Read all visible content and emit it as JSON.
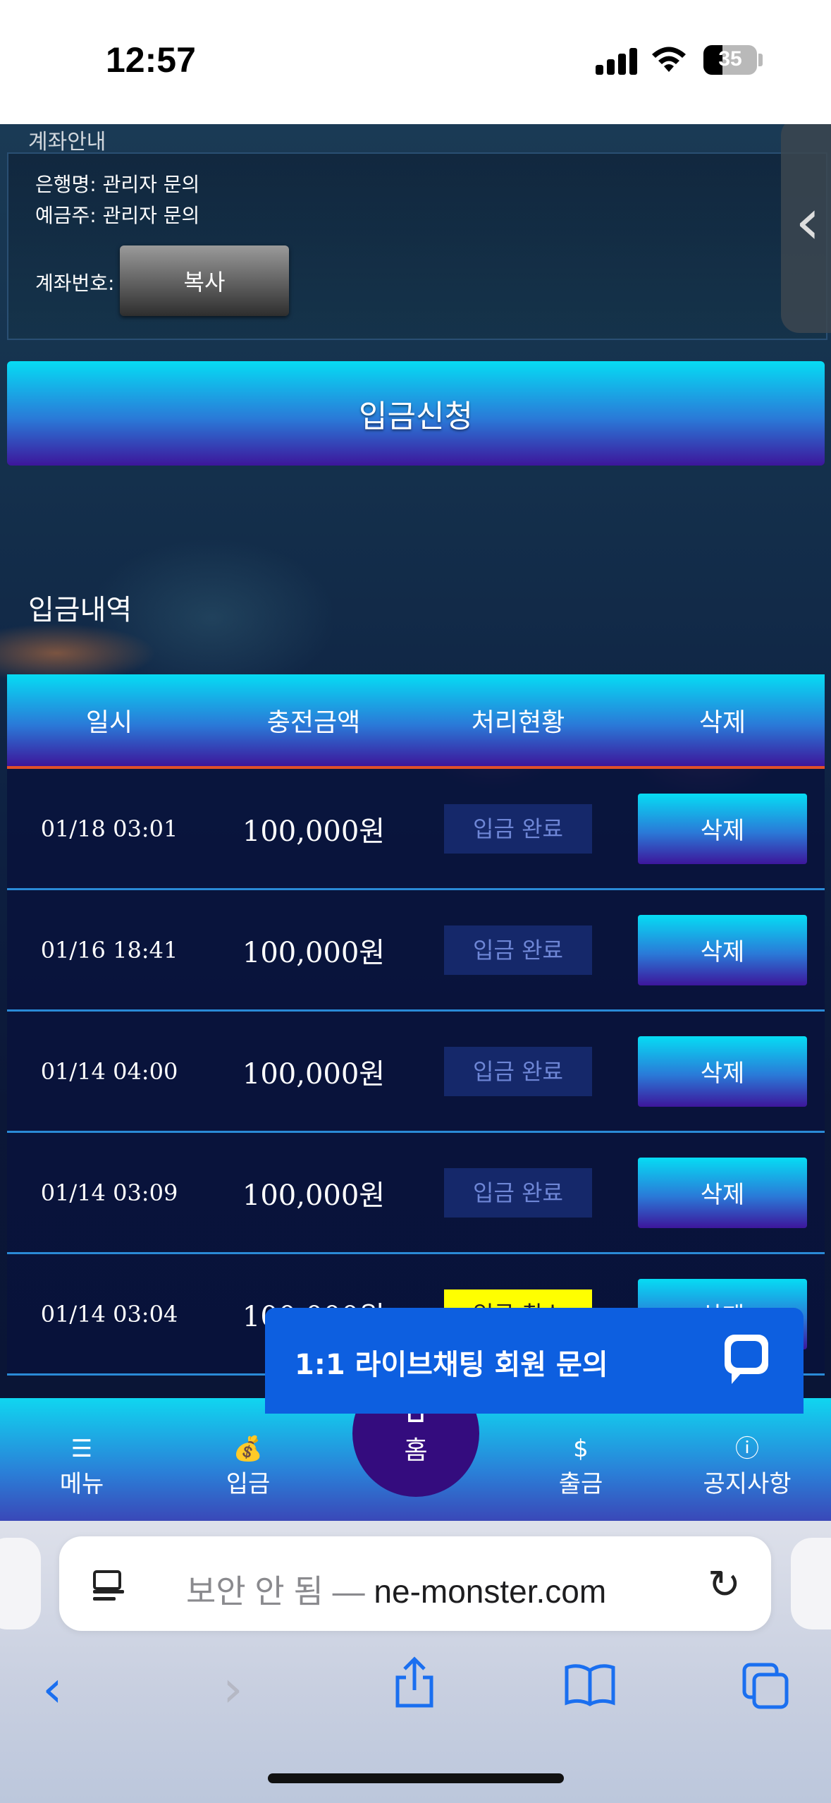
{
  "status_bar": {
    "time": "12:57",
    "battery": "35",
    "battery_level": 0.35
  },
  "account_section": {
    "cut_label": "계좌안내",
    "bank_name": "은행명: 관리자 문의",
    "holder": "예금주: 관리자 문의",
    "account_label": "계좌번호:",
    "copy_button": "복사"
  },
  "deposit_request_button": "입금신청",
  "history_title": "입금내역",
  "table": {
    "headers": [
      "일시",
      "충전금액",
      "처리현황",
      "삭제"
    ],
    "rows": [
      {
        "date": "01/18 03:01",
        "amount": "100,000원",
        "status": "입금 완료",
        "action": "삭제"
      },
      {
        "date": "01/16 18:41",
        "amount": "100,000원",
        "status": "입금 완료",
        "action": "삭제"
      },
      {
        "date": "01/14 04:00",
        "amount": "100,000원",
        "status": "입금 완료",
        "action": "삭제"
      },
      {
        "date": "01/14 03:09",
        "amount": "100,000원",
        "status": "입금 완료",
        "action": "삭제"
      },
      {
        "date": "01/14 03:04",
        "amount": "100,000원",
        "status": "입금 취소",
        "action": "삭제"
      }
    ]
  },
  "chat_banner": "1:1 라이브채팅 회원 문의",
  "bottom_nav": {
    "menu": "메뉴",
    "deposit": "입금",
    "home": "홈",
    "withdraw": "출금",
    "notice": "공지사항"
  },
  "browser": {
    "url_prefix": "보안 안 됨 — ",
    "url_domain": "ne-monster.com"
  },
  "icons": {
    "reader": "reader-icon",
    "reload": "reload-icon",
    "back": "back-icon",
    "forward": "forward-icon",
    "share": "share-icon",
    "bookmarks": "bookmarks-icon",
    "tabs": "tabs-icon"
  }
}
